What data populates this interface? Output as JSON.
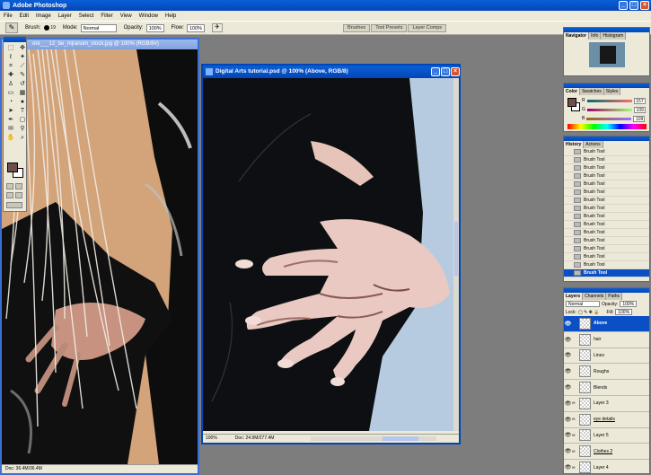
{
  "app": {
    "title": "Adobe Photoshop"
  },
  "menu": [
    "File",
    "Edit",
    "Image",
    "Layer",
    "Select",
    "Filter",
    "View",
    "Window",
    "Help"
  ],
  "options": {
    "brush_label": "Brush:",
    "brush_size": "19",
    "mode_label": "Mode:",
    "mode_value": "Normal",
    "opacity_label": "Opacity:",
    "opacity_value": "100%",
    "flow_label": "Flow:",
    "flow_value": "100%"
  },
  "palette_well": [
    "Brushes",
    "Tool Presets",
    "Layer Comps"
  ],
  "doc1": {
    "title": "ore___12_be_mjranum_stock.jpg @ 100% (RGB/8#)",
    "status": "Doc: 36.4M/36.4M"
  },
  "doc2": {
    "title": "Digital Arts tutorial.psd @ 100% (Above, RGB/8)",
    "zoom": "100%",
    "status": "Doc: 24.9M/277.4M"
  },
  "navigator": {
    "tabs": [
      "Navigator",
      "Info",
      "Histogram"
    ]
  },
  "color_palette": {
    "tabs": [
      "Color",
      "Swatches",
      "Styles"
    ],
    "rows": [
      {
        "label": "R",
        "value": "157",
        "level": 0.62
      },
      {
        "label": "G",
        "value": "109",
        "level": 0.43
      },
      {
        "label": "B",
        "value": "109",
        "level": 0.43
      }
    ],
    "fg_color": "#6e4f4b"
  },
  "history": {
    "tabs": [
      "History",
      "Actions"
    ],
    "items": [
      "Brush Tool",
      "Brush Tool",
      "Brush Tool",
      "Brush Tool",
      "Brush Tool",
      "Brush Tool",
      "Brush Tool",
      "Brush Tool",
      "Brush Tool",
      "Brush Tool",
      "Brush Tool",
      "Brush Tool",
      "Brush Tool",
      "Brush Tool",
      "Brush Tool",
      "Brush Tool"
    ]
  },
  "layers": {
    "tabs": [
      "Layers",
      "Channels",
      "Paths"
    ],
    "blend": "Normal",
    "opacity_label": "Opacity:",
    "opacity_value": "100%",
    "lock_label": "Lock:",
    "fill_label": "Fill:",
    "fill_value": "100%",
    "items": [
      "Above",
      "hair",
      "Lines",
      "Roughs",
      "Blends",
      "Layer 3",
      "eye details",
      "Layer 5",
      "Clothes 2",
      "Layer 4"
    ]
  },
  "colors": {
    "xp_blue": "#0a4fc4",
    "panel_bg": "#ece9d8",
    "workspace": "#7d7d7d"
  }
}
